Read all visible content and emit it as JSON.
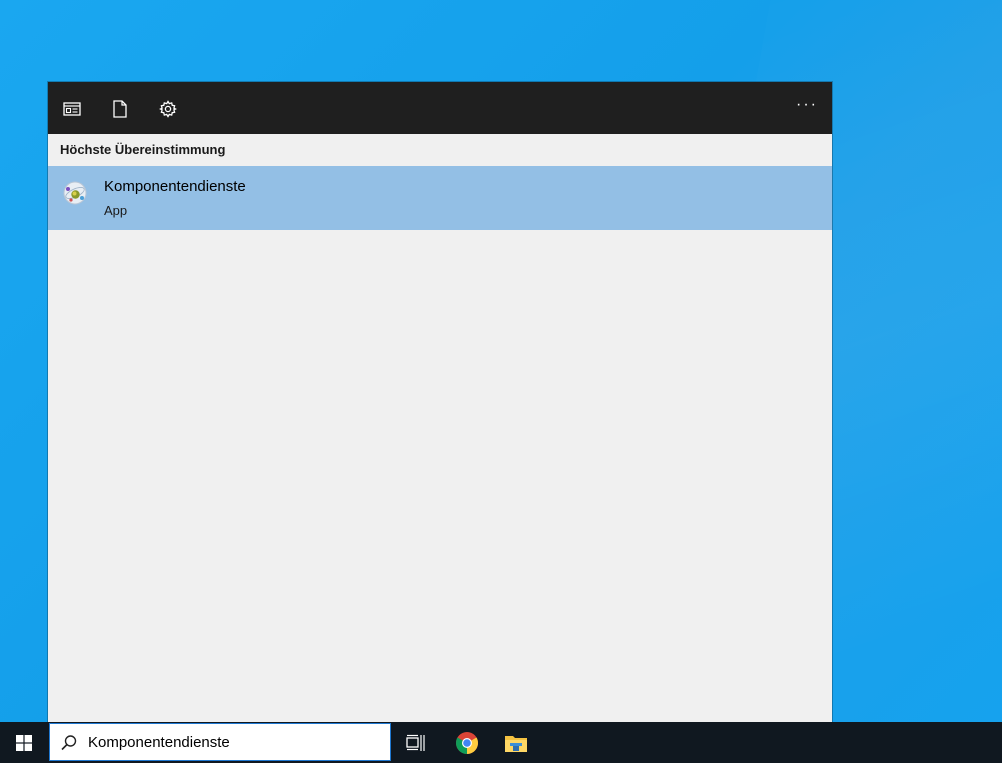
{
  "header": {
    "icons": [
      "apps-icon",
      "documents-icon",
      "settings-icon"
    ],
    "more_label": "···"
  },
  "results": {
    "section_heading": "Höchste Übereinstimmung",
    "best_match": {
      "title": "Komponentendienste",
      "subtitle": "App",
      "icon": "component-services-icon"
    }
  },
  "taskbar": {
    "search": {
      "value": "Komponentendienste"
    },
    "pinned": [
      "task-view-icon",
      "chrome-icon",
      "file-explorer-icon"
    ]
  },
  "colors": {
    "header_bg": "#1f1f1f",
    "panel_bg": "#f0f0f0",
    "selected_bg": "#93bfe5",
    "taskbar_bg": "#101820",
    "desktop": "#1aa7f0"
  }
}
